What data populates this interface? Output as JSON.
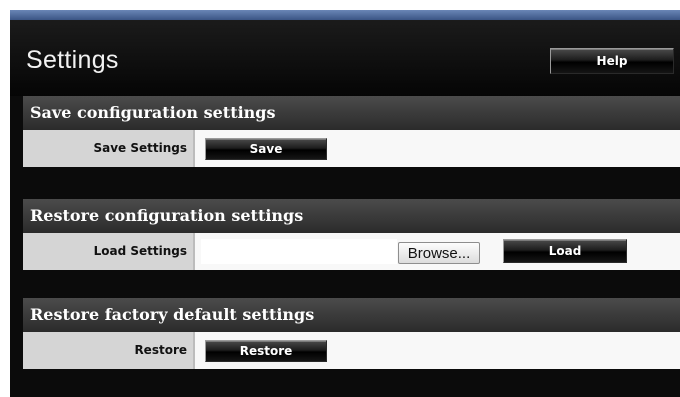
{
  "header": {
    "title": "Settings",
    "help_label": "Help"
  },
  "sections": [
    {
      "title": "Save configuration settings",
      "row_label": "Save Settings",
      "button_label": "Save"
    },
    {
      "title": "Restore configuration settings",
      "row_label": "Load Settings",
      "file_input_value": "",
      "browse_label": "Browse...",
      "button_label": "Load"
    },
    {
      "title": "Restore factory default settings",
      "row_label": "Restore",
      "button_label": "Restore"
    }
  ],
  "colors": {
    "accent_bar": "#4f6a9c",
    "panel_bg": "#0b0b0b",
    "section_header": "#3a3a3a",
    "label_cell": "#d5d5d5"
  }
}
